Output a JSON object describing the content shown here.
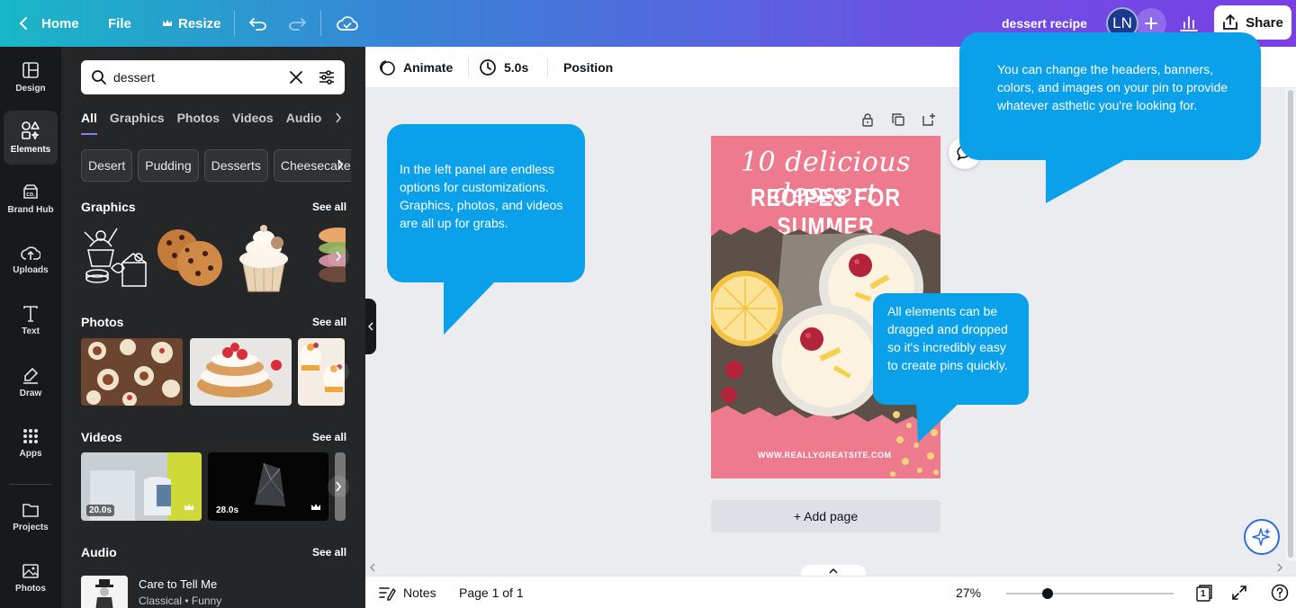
{
  "topbar": {
    "home": "Home",
    "file": "File",
    "resize": "Resize",
    "doc_title": "dessert recipe",
    "avatar_initials": "LN",
    "share": "Share"
  },
  "nav": [
    {
      "label": "Design",
      "icon": "layout-icon"
    },
    {
      "label": "Elements",
      "icon": "shapes-icon"
    },
    {
      "label": "Brand Hub",
      "icon": "brand-icon"
    },
    {
      "label": "Uploads",
      "icon": "cloud-upload-icon"
    },
    {
      "label": "Text",
      "icon": "text-icon"
    },
    {
      "label": "Draw",
      "icon": "pen-icon"
    },
    {
      "label": "Apps",
      "icon": "grid-icon"
    },
    {
      "label": "Projects",
      "icon": "folder-icon"
    },
    {
      "label": "Photos",
      "icon": "image-icon"
    }
  ],
  "panel": {
    "search_value": "dessert",
    "tabs": [
      "All",
      "Graphics",
      "Photos",
      "Videos",
      "Audio"
    ],
    "chips": [
      "Desert",
      "Pudding",
      "Desserts",
      "Cheesecake"
    ],
    "graphics_title": "Graphics",
    "photos_title": "Photos",
    "videos_title": "Videos",
    "audio_title": "Audio",
    "see_all": "See all",
    "videos": [
      {
        "duration": "20.0s"
      },
      {
        "duration": "28.0s"
      }
    ],
    "audio_track": {
      "title": "Care to Tell Me",
      "subtitle": "Classical • Funny"
    }
  },
  "editor_toolbar": {
    "animate": "Animate",
    "duration": "5.0s",
    "position": "Position"
  },
  "pin": {
    "title_script": "10 delicious dessert",
    "title_caps": "RECIPES FOR SUMMER",
    "url": "WWW.REALLYGREATSITE.COM"
  },
  "add_page": "+ Add page",
  "callouts": {
    "left": "In the left panel are endless options for customizations. Graphics, photos, and videos are all up for grabs.",
    "top_right": "You can change the headers, banners, colors, and images on your pin to provide whatever asthetic you're looking for.",
    "middle": "All elements can be dragged and dropped so it's incredibly easy to create pins quickly."
  },
  "bottombar": {
    "notes": "Notes",
    "page_info": "Page 1 of 1",
    "zoom": "27%",
    "page_count": "1"
  },
  "colors": {
    "callout": "#0aa1ea",
    "pin_background": "#ee7b8d",
    "panel": "#252627",
    "nav": "#18191b"
  }
}
